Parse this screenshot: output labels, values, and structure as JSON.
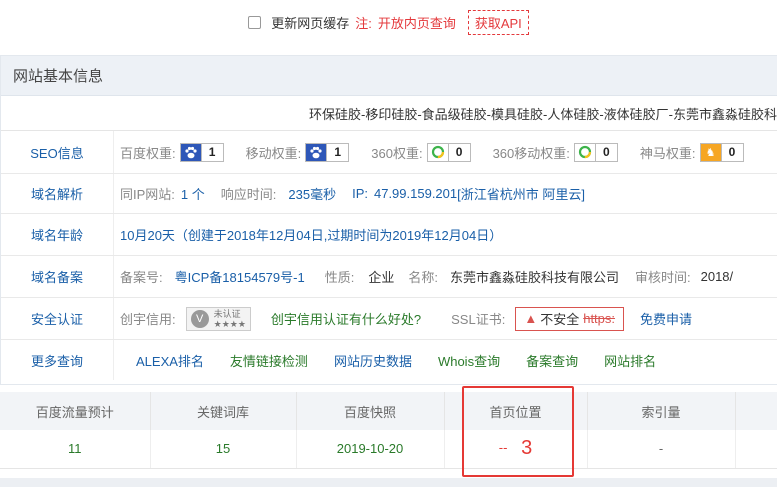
{
  "topbar": {
    "checkbox_label": "更新网页缓存",
    "note_prefix": "注:",
    "note_text": "开放内页查询",
    "api_button": "获取API"
  },
  "panel": {
    "title": "网站基本信息",
    "keywords": "环保硅胶-移印硅胶-食品级硅胶-模具硅胶-人体硅胶-液体硅胶厂-东莞市鑫淼硅胶科"
  },
  "seo": {
    "label": "SEO信息",
    "baidu_label": "百度权重:",
    "baidu_value": "1",
    "mobile_label": "移动权重:",
    "mobile_value": "1",
    "s360_label": "360权重:",
    "s360_value": "0",
    "s360m_label": "360移动权重:",
    "s360m_value": "0",
    "shenma_label": "神马权重:",
    "shenma_value": "0"
  },
  "dns": {
    "label": "域名解析",
    "same_ip_label": "同IP网站:",
    "same_ip_value": "1 个",
    "resp_label": "响应时间:",
    "resp_value": "235毫秒",
    "ip_label": "IP:",
    "ip_value": "47.99.159.201",
    "ip_loc": "[浙江省杭州市 阿里云]"
  },
  "age": {
    "label": "域名年龄",
    "value": "10月20天（创建于2018年12月04日,过期时间为2019年12月04日）"
  },
  "icp": {
    "label": "域名备案",
    "num_label": "备案号:",
    "num_value": "粤ICP备18154579号-1",
    "type_label": "性质:",
    "type_value": "企业",
    "name_label": "名称:",
    "name_value": "东莞市鑫淼硅胶科技有限公司",
    "time_label": "审核时间:",
    "time_value": "2018/"
  },
  "security": {
    "label": "安全认证",
    "credit_label": "创宇信用:",
    "badge_text": "未认证",
    "badge_stars": "★★★★",
    "credit_link": "创宇信用认证有什么好处?",
    "ssl_label": "SSL证书:",
    "unsafe_text": "不安全",
    "https_text": "https:",
    "free_apply": "免费申请"
  },
  "more": {
    "label": "更多查询",
    "links": [
      "ALEXA排名",
      "友情链接检测",
      "网站历史数据",
      "Whois查询",
      "备案查询",
      "网站排名"
    ]
  },
  "stats": {
    "headers": [
      "百度流量预计",
      "关键词库",
      "百度快照",
      "首页位置",
      "索引量",
      ""
    ],
    "values": [
      "11",
      "15",
      "2019-10-20",
      "--",
      "-",
      ""
    ],
    "annotation": "3"
  },
  "colors": {
    "link_blue": "#1a5fa8",
    "value_green": "#2a7a2a",
    "alert_red": "#e53935",
    "header_bg": "#edf1f6"
  }
}
